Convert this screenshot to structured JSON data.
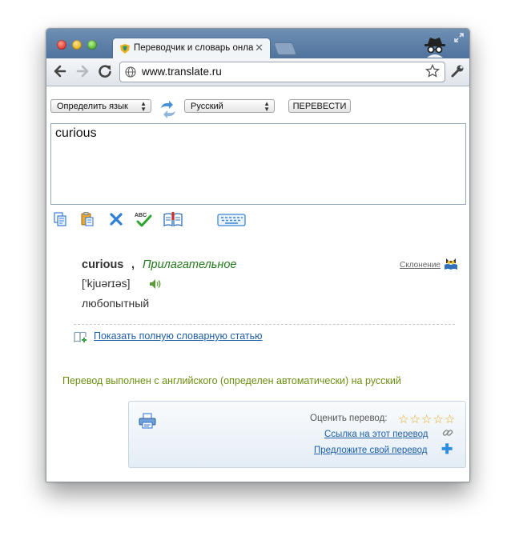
{
  "browser": {
    "tab_title": "Переводчик и словарь онла",
    "url": "www.translate.ru"
  },
  "translator": {
    "source_language": "Определить язык",
    "target_language": "Русский",
    "translate_button": "ПЕРЕВЕСТИ",
    "input_text": "curious"
  },
  "result": {
    "word": "curious",
    "comma": ",",
    "part_of_speech": "Прилагательное",
    "declension_link": "Склонение",
    "transcription": "['kjuərɪəs]",
    "translation": "любопытный",
    "full_entry_link": "Показать полную словарную статью",
    "direction_note": "Перевод выполнен с английского (определен автоматически) на русский"
  },
  "rating": {
    "rate_label": "Оценить перевод:",
    "stars": "☆☆☆☆☆",
    "link_label": "Ссылка на этот перевод",
    "suggest_label": "Предложите свой перевод"
  },
  "colors": {
    "titlebar": "#5b7ea8",
    "link": "#1f5ea8",
    "part_of_speech": "#227a1c",
    "direction_note": "#6b8f11",
    "stars": "#e6a817"
  }
}
